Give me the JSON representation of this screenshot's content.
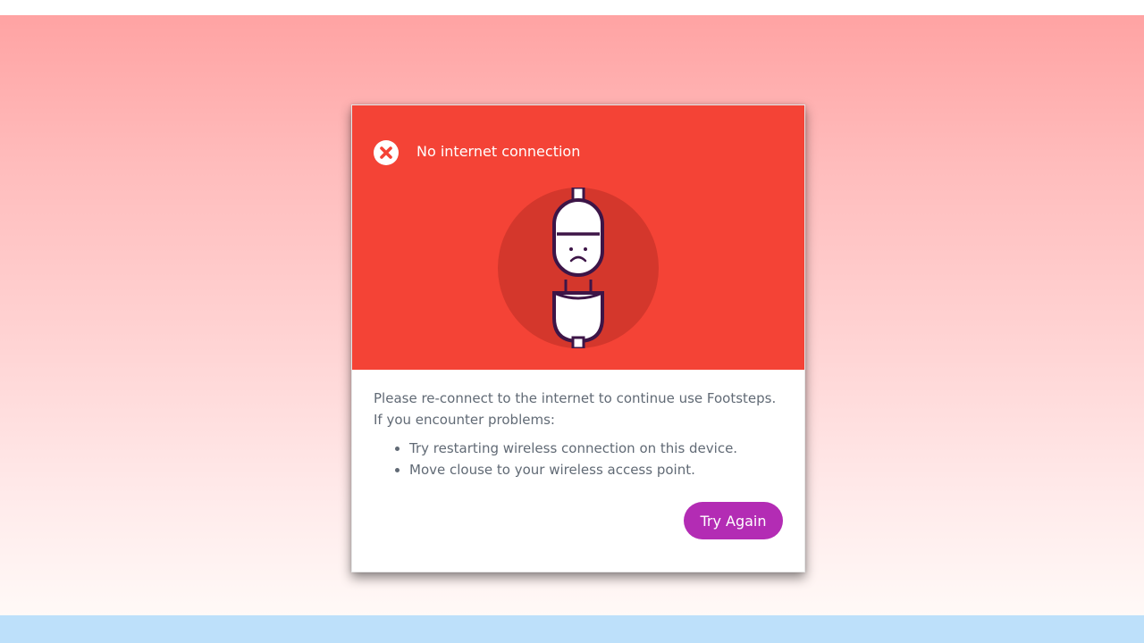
{
  "dialog": {
    "title": "No internet connection",
    "header_color": "#f44336",
    "error_icon": "close-circle-icon",
    "illustration": "unplugged-cable-sad-face",
    "message_line1": "Please re-connect to the internet to continue use Footsteps.",
    "message_line2": "If you encounter problems:",
    "tips": [
      "Try restarting wireless connection on this device.",
      "Move clouse to your wireless access point."
    ],
    "button_label": "Try Again",
    "button_color": "#b32cb4"
  }
}
